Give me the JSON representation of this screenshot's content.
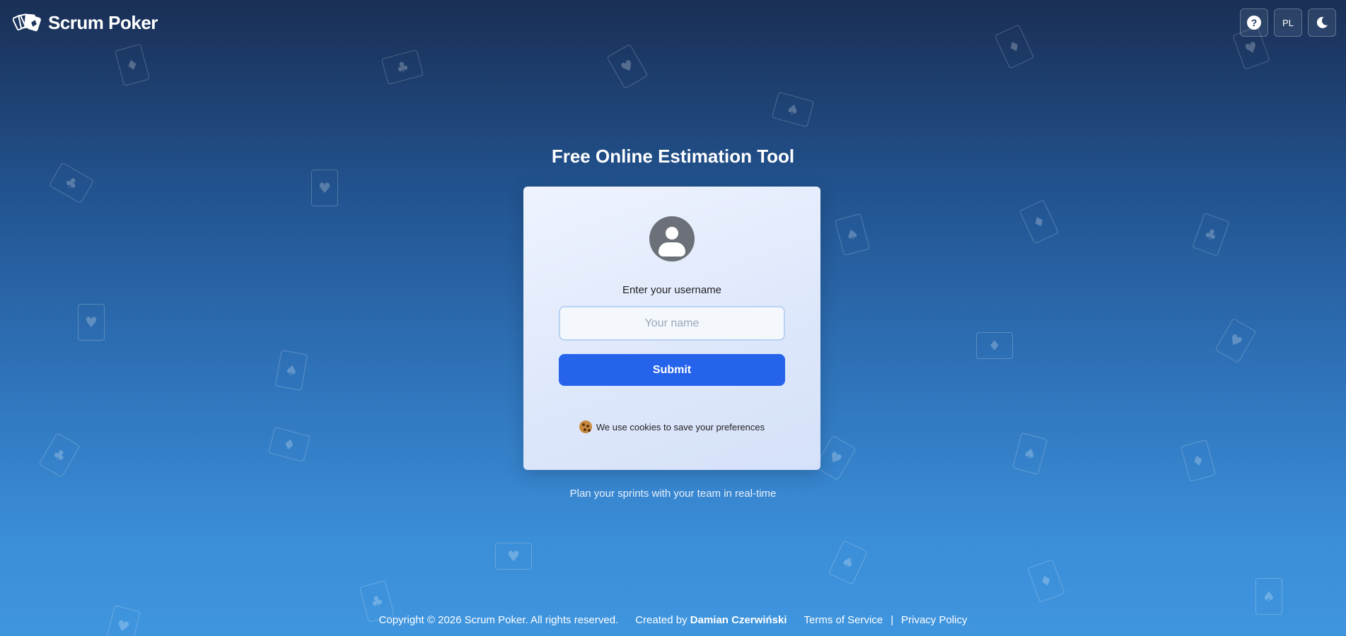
{
  "header": {
    "brand_name": "Scrum Poker",
    "logo_icon": "playing-cards-logo-icon",
    "help_icon": "question-circle-icon",
    "help_glyph": "?",
    "language_label": "PL",
    "theme_icon": "moon-icon"
  },
  "main": {
    "title": "Free Online Estimation Tool",
    "card": {
      "avatar_icon": "user-avatar-icon",
      "prompt": "Enter your username",
      "name_placeholder": "Your name",
      "submit_label": "Submit",
      "cookie_icon": "cookie-icon",
      "cookie_notice": "We use cookies to save your preferences"
    },
    "tagline": "Plan your sprints with your team in real-time"
  },
  "footer": {
    "copyright": "Copyright © 2026 Scrum Poker. All rights reserved.",
    "created_prefix": "Created by",
    "author": "Damian Czerwiński",
    "terms_label": "Terms of Service",
    "separator": "|",
    "privacy_label": "Privacy Policy"
  },
  "colors": {
    "background_top": "#1a2f55",
    "background_bottom": "#3f95de",
    "submit_button": "#2563eb",
    "card_background": "#e6eefc"
  },
  "background_decoration": {
    "suits": [
      "♦",
      "♣",
      "♥",
      "♠",
      "♦",
      "♥",
      "♣",
      "♥",
      "♠",
      "♦",
      "♣",
      "♥",
      "♦",
      "♥",
      "♠",
      "♦",
      "♣",
      "♥",
      "♠",
      "♦",
      "♥",
      "♠",
      "♦",
      "♣",
      "♥",
      "♠"
    ]
  }
}
